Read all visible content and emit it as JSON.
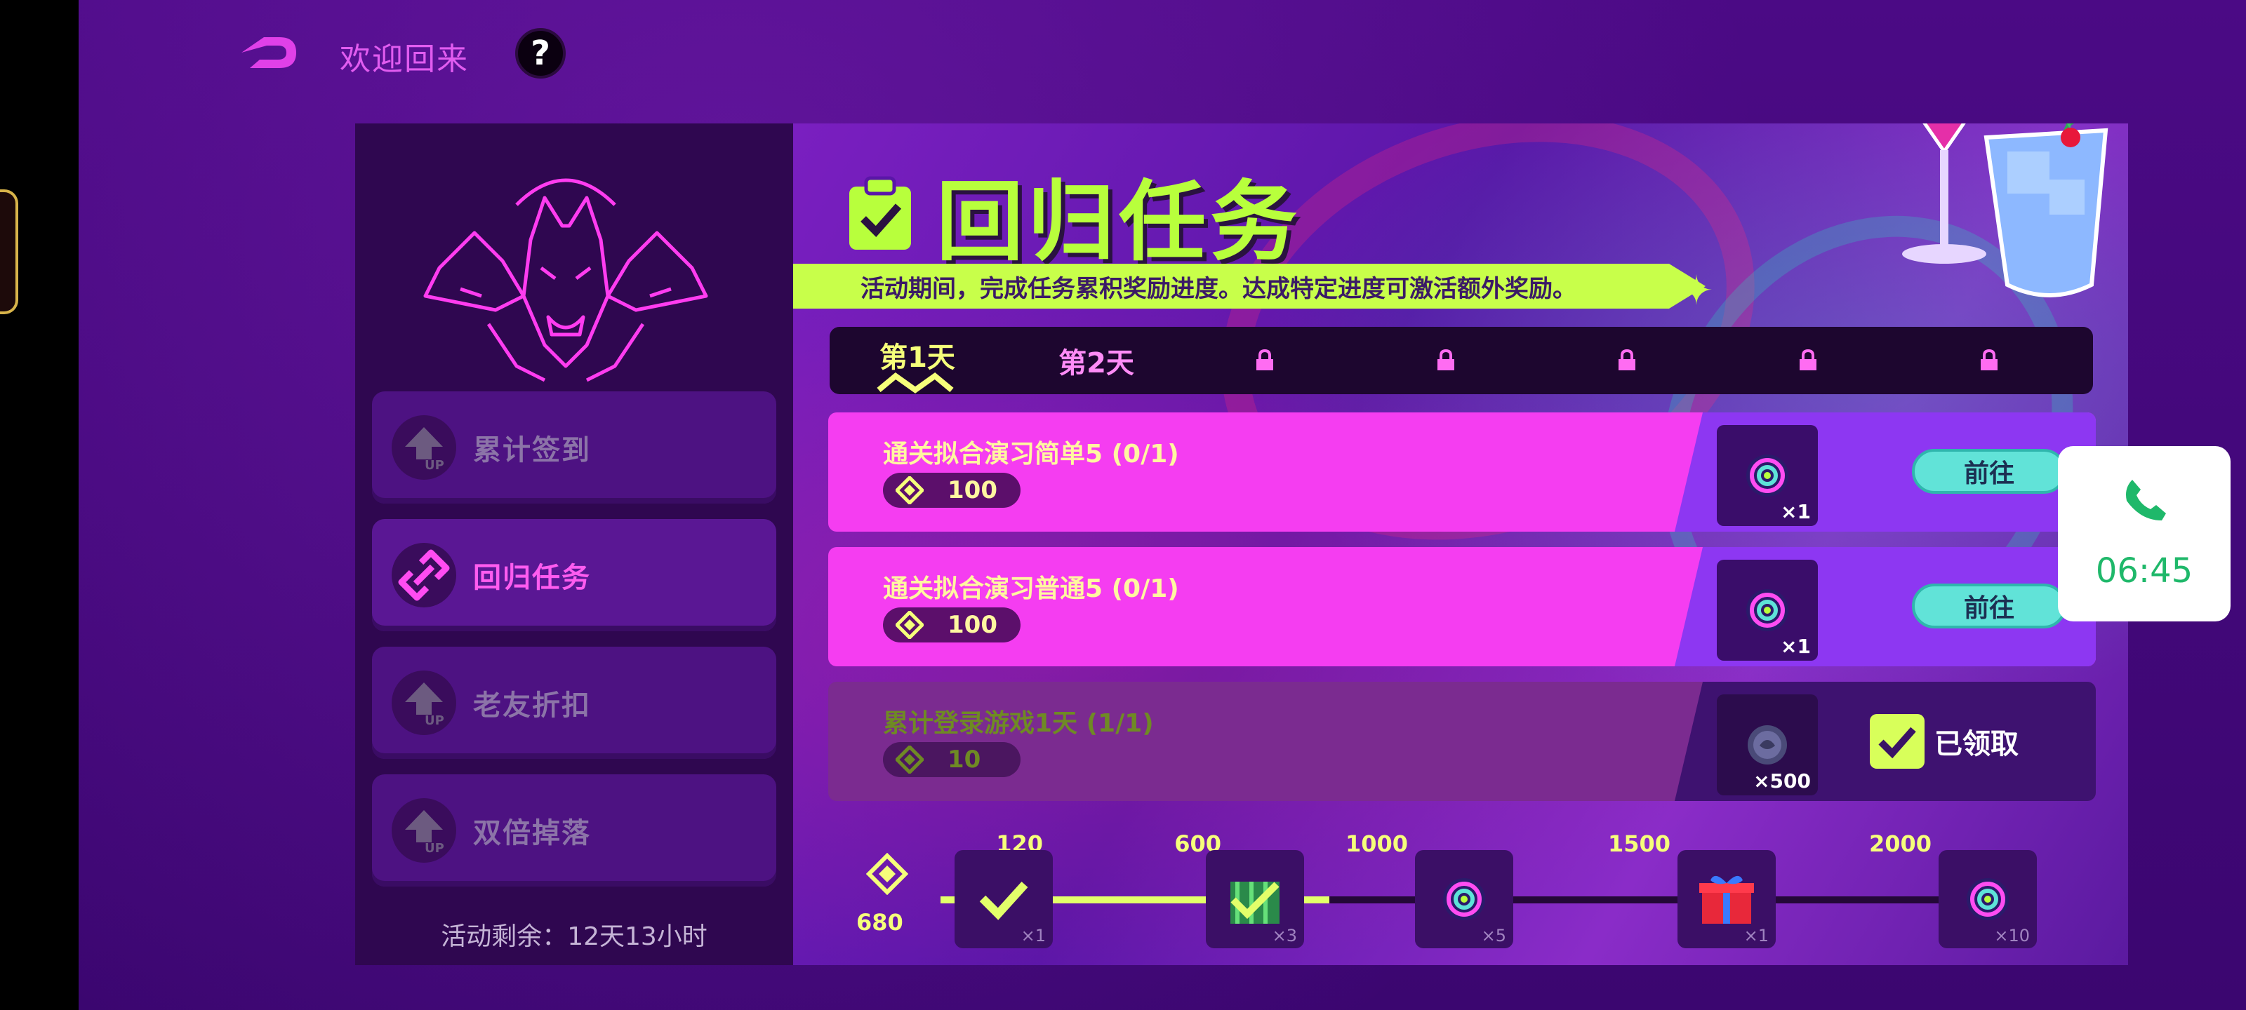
{
  "header": {
    "welcome_text": "欢迎回来",
    "help_label": "?"
  },
  "sidebar": {
    "items": [
      {
        "label": "累计签到",
        "active": false
      },
      {
        "label": "回归任务",
        "active": true
      },
      {
        "label": "老友折扣",
        "active": false
      },
      {
        "label": "双倍掉落",
        "active": false
      }
    ],
    "remaining_text": "活动剩余：12天13小时"
  },
  "main": {
    "title": "回归任务",
    "description": "活动期间，完成任务累积奖励进度。达成特定进度可激活额外奖励。",
    "tabs": [
      {
        "label": "第1天",
        "state": "active"
      },
      {
        "label": "第2天",
        "state": "open"
      },
      {
        "label": "",
        "state": "locked"
      },
      {
        "label": "",
        "state": "locked"
      },
      {
        "label": "",
        "state": "locked"
      },
      {
        "label": "",
        "state": "locked"
      },
      {
        "label": "",
        "state": "locked"
      }
    ],
    "tasks": [
      {
        "name": "通关拟合演习简单5 (0/1)",
        "points": "100",
        "reward_qty": "×1",
        "reward_icon": "target-token-icon",
        "action": "前往",
        "done": false
      },
      {
        "name": "通关拟合演习普通5 (0/1)",
        "points": "100",
        "reward_qty": "×1",
        "reward_icon": "target-token-icon",
        "action": "前往",
        "done": false
      },
      {
        "name": "累计登录游戏1天 (1/1)",
        "points": "10",
        "reward_qty": "×500",
        "reward_icon": "coin-icon",
        "action": "已领取",
        "done": true
      }
    ]
  },
  "progress": {
    "current": "680",
    "fill_fraction": 0.36,
    "milestones": [
      {
        "threshold": "120",
        "qty": "×1",
        "icon": "claimed-reward-icon",
        "claimed": true
      },
      {
        "threshold": "600",
        "qty": "×3",
        "icon": "green-box-icon",
        "claimed": true
      },
      {
        "threshold": "1000",
        "qty": "×5",
        "icon": "target-token-icon",
        "claimed": false
      },
      {
        "threshold": "1500",
        "qty": "×1",
        "icon": "gift-box-icon",
        "claimed": false
      },
      {
        "threshold": "2000",
        "qty": "×10",
        "icon": "target-token-icon",
        "claimed": false
      }
    ]
  },
  "call_widget": {
    "time": "06:45",
    "icon": "phone-icon",
    "color": "#1fb86a"
  },
  "colors": {
    "accent_lime": "#b8ff3c",
    "accent_pink": "#f53df1",
    "accent_teal": "#61e3d8",
    "background_purple": "#4b0a85"
  }
}
